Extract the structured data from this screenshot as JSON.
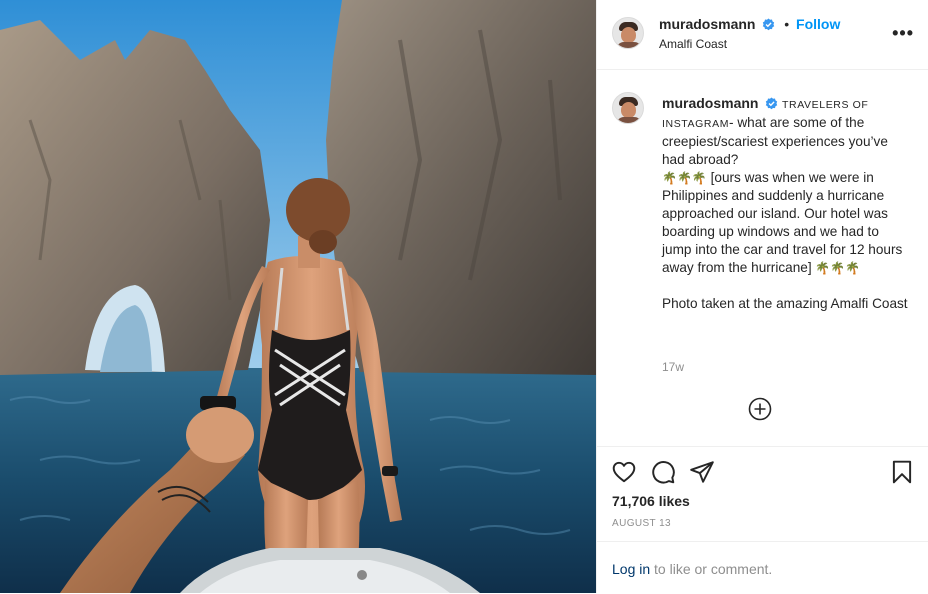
{
  "post": {
    "username": "muradosmann",
    "follow_label": "Follow",
    "separator": "•",
    "location": "Amalfi Coast",
    "more_label": "•••"
  },
  "caption": {
    "username": "muradosmann",
    "tag": "TRAVELERS OF INSTAGRAM",
    "question": "- what are some of the creepiest/scariest experiences you’ve had abroad?",
    "palms_a": "🌴🌴🌴",
    "story": " [ours was when we were in Philippines and suddenly a hurricane approached our island. Our hotel was boarding up windows and we had to jump into the car and travel for 12 hours away from the hurricane] ",
    "palms_b": "🌴🌴🌴",
    "photo_note": "Photo taken at the amazing Amalfi Coast",
    "time": "17w"
  },
  "stats": {
    "likes": "71,706 likes",
    "date": "AUGUST 13"
  },
  "login": {
    "link_label": "Log in",
    "rest": " to like or comment."
  },
  "icons": {
    "verified": "verified-badge-icon",
    "more": "more-options-icon",
    "load_more": "plus-circle-icon",
    "like": "heart-icon",
    "comment": "comment-icon",
    "share": "share-icon",
    "save": "bookmark-icon"
  },
  "colors": {
    "accent": "#0095f6",
    "verified": "#3897f0",
    "muted": "#8e8e8e",
    "text": "#262626",
    "link": "#00376b",
    "water": "#1d4d6b",
    "sky": "#2f8fd6"
  }
}
